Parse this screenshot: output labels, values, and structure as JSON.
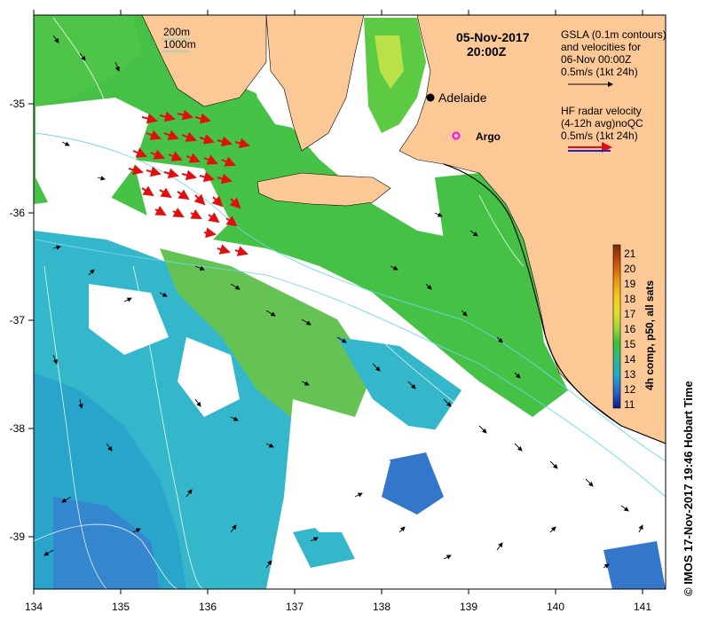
{
  "header": {
    "date": "05-Nov-2017",
    "time": "20:00Z"
  },
  "legend": {
    "contour_200": "200m",
    "contour_1000": "1000m",
    "gsla_line1": "GSLA (0.1m contours)",
    "gsla_line2": "and velocities for",
    "gsla_line3": "06-Nov 00:00Z",
    "gsla_line4": "0.5m/s (1kt 24h)",
    "hf_line1": "HF radar velocity",
    "hf_line2": "(4-12h avg)noQC",
    "hf_line3": "0.5m/s (1kt 24h)"
  },
  "places": {
    "adelaide": "Adelaide",
    "argo": "Argo"
  },
  "axes": {
    "x_ticks": [
      "134",
      "135",
      "136",
      "137",
      "138",
      "139",
      "140",
      "141"
    ],
    "y_ticks": [
      "-35",
      "-36",
      "-37",
      "-38",
      "-39"
    ]
  },
  "colorbar": {
    "ticks": [
      "21",
      "20",
      "19",
      "18",
      "17",
      "16",
      "15",
      "14",
      "13",
      "12",
      "11"
    ],
    "title": "4h comp, p50, all sats",
    "colors": [
      "#7a2a0a",
      "#c24c0c",
      "#e78a14",
      "#f4c21c",
      "#e8e028",
      "#a8d838",
      "#3cc23c",
      "#2cb890",
      "#1ea8d0",
      "#2a68c8",
      "#141494"
    ]
  },
  "credit": "© IMOS 17-Nov-2017 19:46 Hobart Time",
  "colors": {
    "land": "#fbc896",
    "green": "#3cbf3c",
    "cyan": "#2ab4c8",
    "blue": "#3070c8",
    "hf_arrow": "#e01010"
  }
}
